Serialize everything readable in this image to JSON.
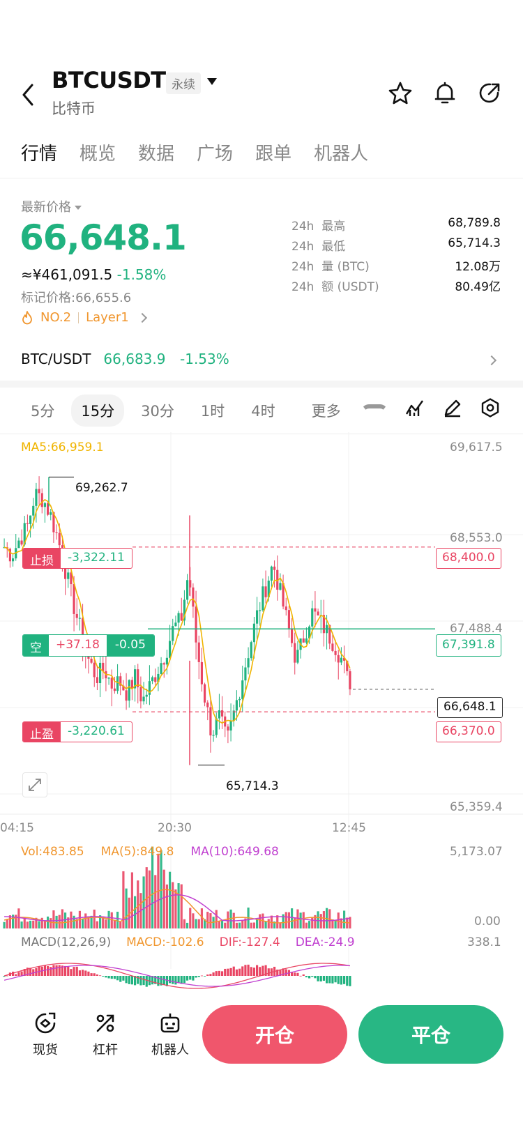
{
  "header": {
    "symbol": "BTCUSDT",
    "contract_type": "永续",
    "name": "比特币"
  },
  "tabs": [
    "行情",
    "概览",
    "数据",
    "广场",
    "跟单",
    "机器人"
  ],
  "price": {
    "label": "最新价格",
    "last": "66,648.1",
    "cny": "≈¥461,091.5",
    "change": "-1.58%",
    "mark_label": "标记价格:",
    "mark": "66,655.6",
    "rank_tag": "NO.2",
    "category_tag": "Layer1"
  },
  "stats": [
    {
      "k1": "24h",
      "k2": "最高",
      "v": "68,789.8"
    },
    {
      "k1": "24h",
      "k2": "最低",
      "v": "65,714.3"
    },
    {
      "k1": "24h",
      "k2": "量 (BTC)",
      "v": "12.08万"
    },
    {
      "k1": "24h",
      "k2": "额 (USDT)",
      "v": "80.49亿"
    }
  ],
  "spot": {
    "pair": "BTC/USDT",
    "price": "66,683.9",
    "change": "-1.53%"
  },
  "timeframes": [
    "5分",
    "15分",
    "30分",
    "1时",
    "4时",
    "更多"
  ],
  "chart": {
    "ma5": "MA5:66,959.1",
    "axis_prices": [
      "69,617.5",
      "68,553.0",
      "67,488.4",
      "65,359.4"
    ],
    "high_marker": "69,262.7",
    "low_marker": "65,714.3",
    "current_price_tag": "66,648.1",
    "stop_loss": {
      "label": "止损",
      "pnl": "-3,322.11",
      "price": "68,400.0"
    },
    "position": {
      "side": "空",
      "pnl": "+37.18",
      "qty": "-0.05",
      "price": "67,391.8"
    },
    "take_profit": {
      "label": "止盈",
      "pnl": "-3,220.61",
      "price": "66,370.0"
    },
    "time_labels": [
      "04:15",
      "20:30",
      "12:45"
    ],
    "volume": {
      "vol": "Vol:483.85",
      "ma5": "MA(5):849.8",
      "ma10": "MA(10):649.68",
      "max": "5,173.07",
      "min": "0.00"
    },
    "macd": {
      "params": "MACD(12,26,9)",
      "macd": "MACD:-102.6",
      "dif": "DIF:-127.4",
      "dea": "DEA:-24.9",
      "max": "338.1"
    }
  },
  "colors": {
    "up": "#20b27f",
    "down": "#e94563",
    "ma5": "#f0b400",
    "ma10": "#c040d0",
    "accent_orange": "#f0962e"
  },
  "chart_data": {
    "type": "candlestick",
    "interval": "15分",
    "ylim": [
      65359.4,
      69617.5
    ],
    "close_approx": [
      68400,
      68300,
      68500,
      68650,
      69050,
      69000,
      68800,
      68500,
      68100,
      67700,
      67350,
      67000,
      66800,
      66900,
      66700,
      66750,
      66600,
      66800,
      66500,
      66700,
      66900,
      67100,
      67400,
      67500,
      68100,
      67200,
      66600,
      66100,
      66300,
      66000,
      66400,
      66800,
      67200,
      67600,
      67900,
      68200,
      67800,
      67400,
      67000,
      67300,
      67600,
      67500,
      67350,
      67200,
      67000,
      66648.1
    ],
    "high": 69262.7,
    "low": 65714.3
  },
  "bottom_nav": [
    "现货",
    "杠杆",
    "机器人"
  ],
  "actions": {
    "open": "开仓",
    "close": "平仓"
  }
}
